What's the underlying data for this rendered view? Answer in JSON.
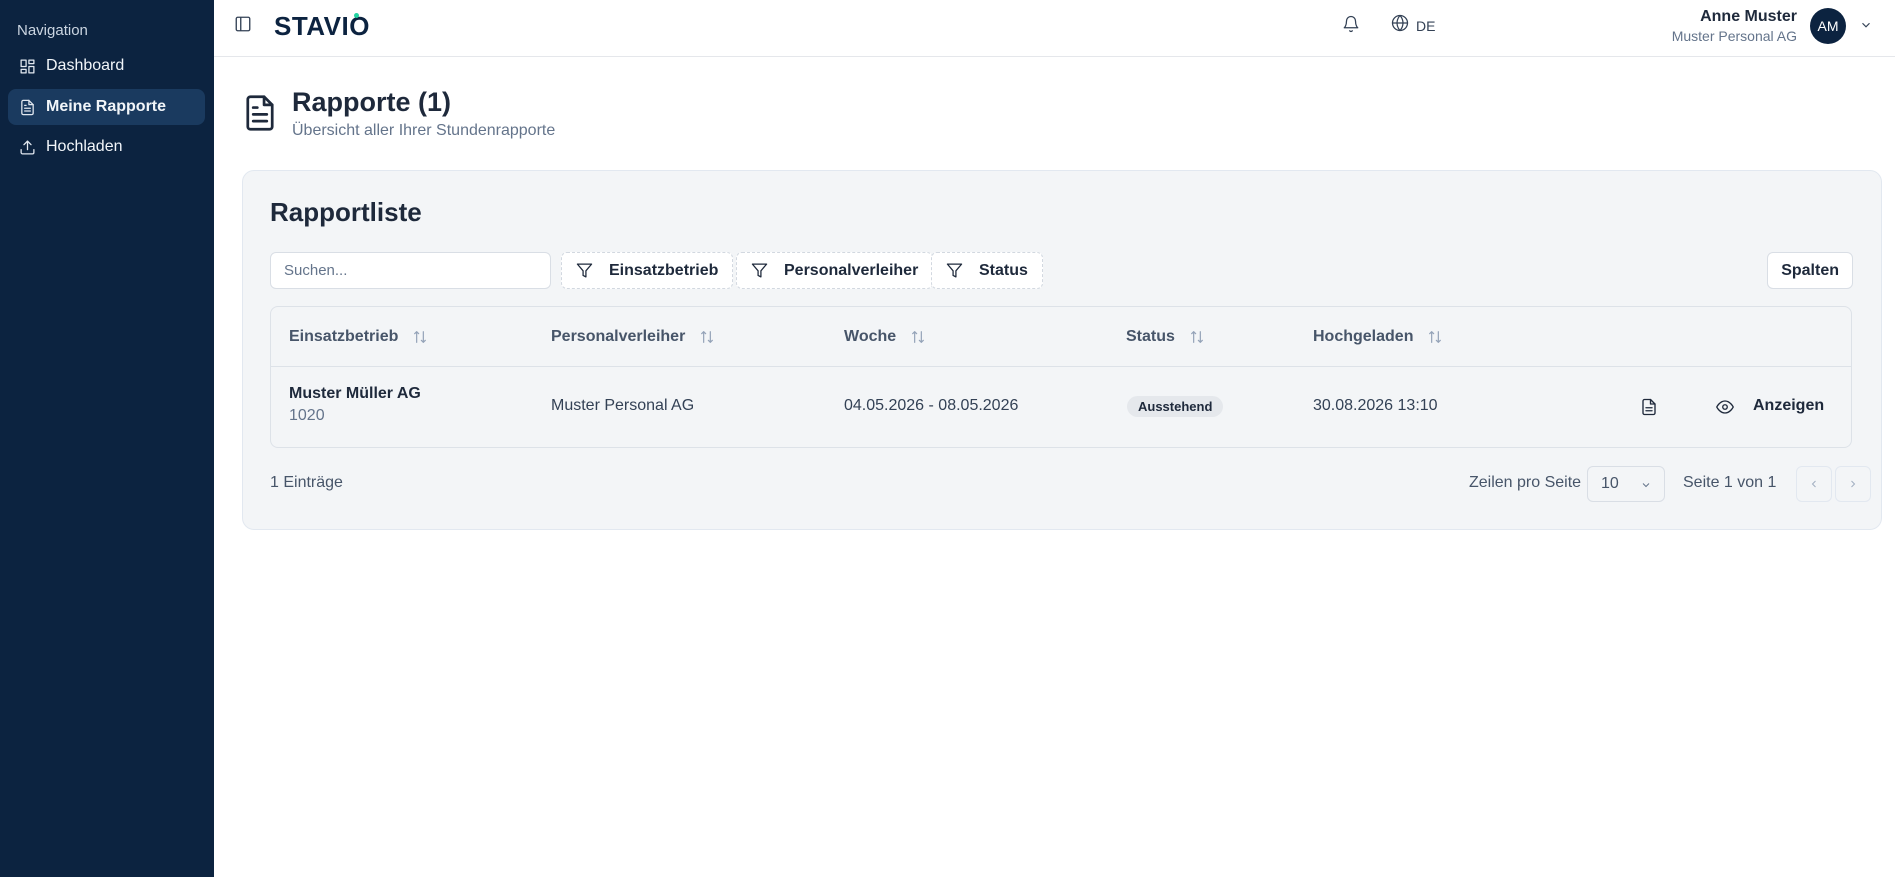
{
  "sidebar": {
    "title": "Navigation",
    "items": [
      {
        "label": "Dashboard",
        "icon": "dashboard-icon"
      },
      {
        "label": "Meine Rapporte",
        "icon": "document-icon",
        "active": true
      },
      {
        "label": "Hochladen",
        "icon": "upload-icon"
      }
    ]
  },
  "header": {
    "logo": "STAVIO",
    "language": "DE",
    "user": {
      "name": "Anne Muster",
      "company": "Muster Personal AG",
      "initials": "AM"
    }
  },
  "page": {
    "title": "Rapporte (1)",
    "subtitle": "Übersicht aller Ihrer Stundenrapporte"
  },
  "card": {
    "title": "Rapportliste",
    "search_placeholder": "Suchen...",
    "filters": [
      "Einsatzbetrieb",
      "Personalverleiher",
      "Status"
    ],
    "columns_button": "Spalten",
    "table": {
      "headers": [
        "Einsatzbetrieb",
        "Personalverleiher",
        "Woche",
        "Status",
        "Hochgeladen"
      ],
      "rows": [
        {
          "company": "Muster Müller AG",
          "company_id": "1020",
          "lender": "Muster Personal AG",
          "week": "04.05.2026 - 08.05.2026",
          "status": "Ausstehend",
          "uploaded": "30.08.2026 13:10",
          "action_label": "Anzeigen"
        }
      ]
    },
    "footer": {
      "entries": "1 Einträge",
      "rows_per_page_label": "Zeilen pro Seite",
      "rows_per_page_value": "10",
      "page_label": "Seite 1 von 1"
    }
  },
  "colors": {
    "sidebar_bg": "#0c2340",
    "card_bg": "#f3f5f7",
    "accent_dot": "#22d3a1"
  }
}
